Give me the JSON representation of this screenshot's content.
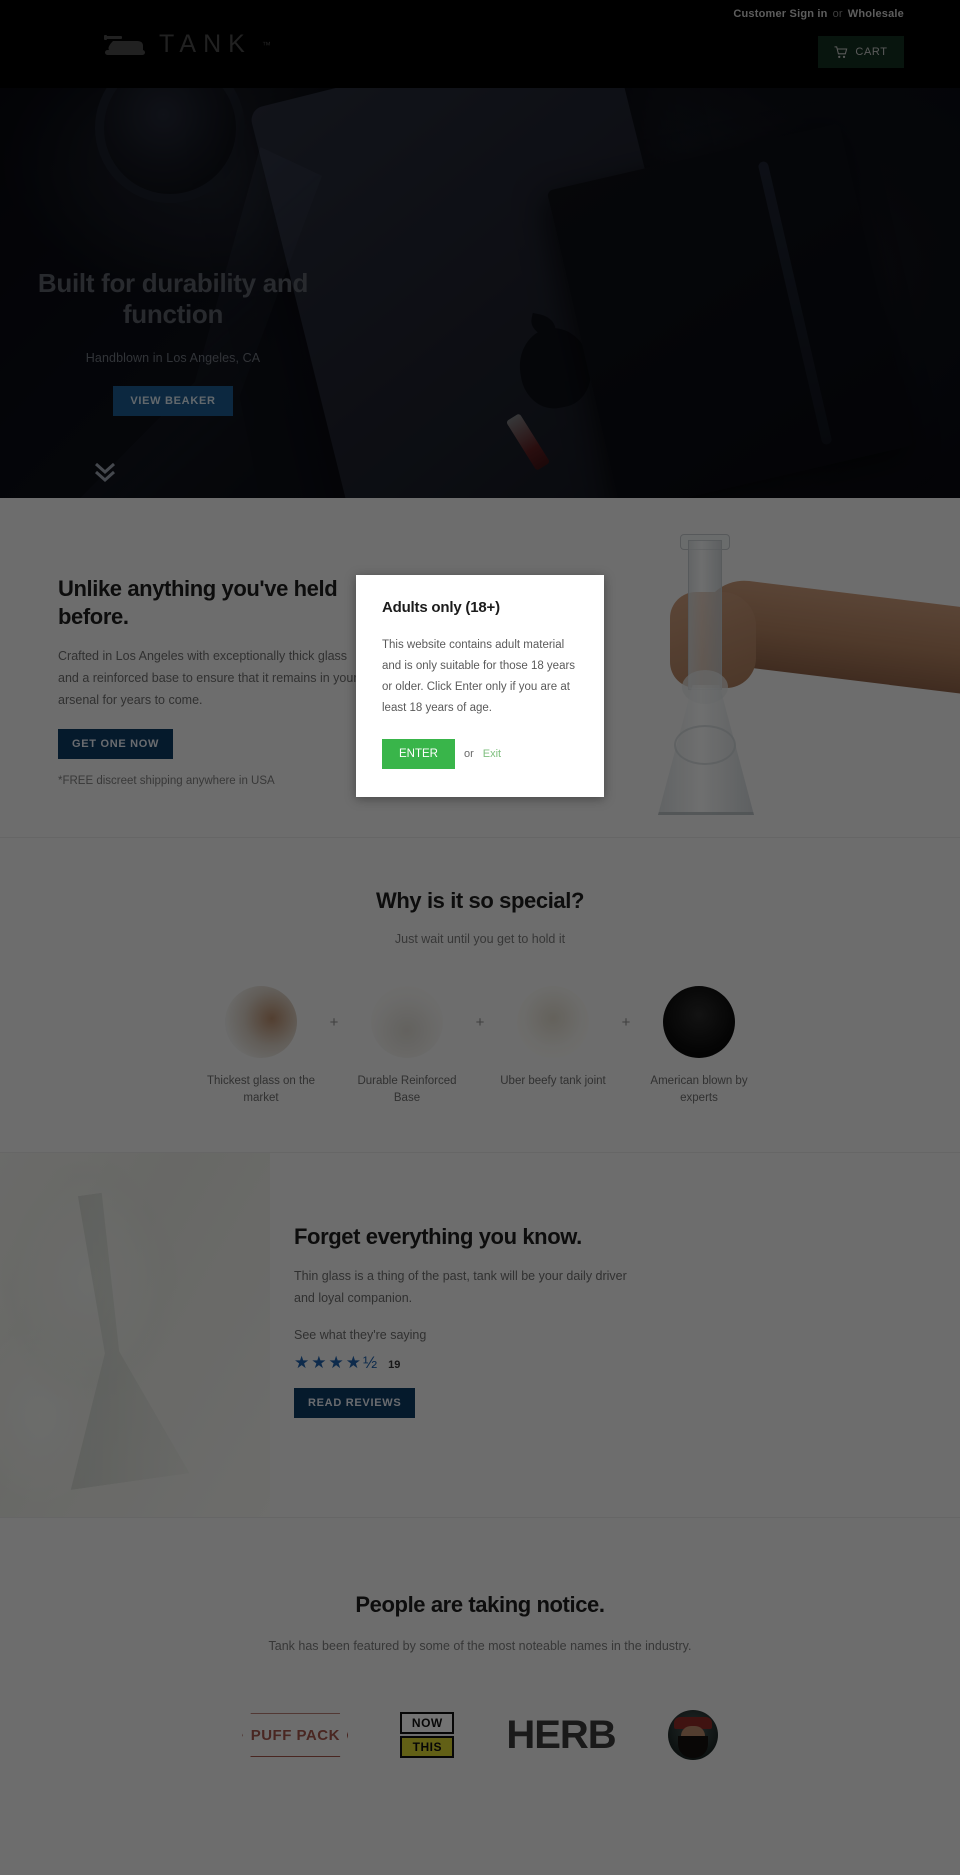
{
  "header": {
    "utility": {
      "signin_label": "Customer Sign in",
      "separator": "or",
      "wholesale_label": "Wholesale"
    },
    "logo": {
      "wordmark": "TANK",
      "tm": "™",
      "icon": "tank-icon"
    },
    "cart": {
      "label": "CART",
      "icon": "shopping-cart-icon",
      "bg": "#133020"
    }
  },
  "hero": {
    "title": "Built for durability and function",
    "subtitle": "Handblown in Los Angeles, CA",
    "cta_label": "VIEW BEAKER",
    "cta_color": "#1b5a8f",
    "scroll_icon": "double-chevron-down-icon"
  },
  "unlike": {
    "heading": "Unlike anything you've held before.",
    "body": "Crafted in Los Angeles with exceptionally thick glass and a reinforced base to ensure that it remains in your arsenal for years to come.",
    "cta_label": "GET ONE NOW",
    "cta_color": "#0d3a63",
    "footnote": "*FREE discreet shipping anywhere in USA"
  },
  "special": {
    "heading": "Why is it so special?",
    "subheading": "Just wait until you get to hold it",
    "separator": "+",
    "features": [
      {
        "caption": "Thickest glass on the market"
      },
      {
        "caption": "Durable Reinforced Base"
      },
      {
        "caption": "Uber beefy tank joint"
      },
      {
        "caption": "American blown by experts"
      }
    ]
  },
  "forget": {
    "heading": "Forget everything you know.",
    "body": "Thin glass is a thing of the past, tank will be your daily driver and loyal companion.",
    "see_what": "See what they're saying",
    "stars": "★★★★½",
    "rating": 4.5,
    "review_count": "19",
    "cta_label": "READ REVIEWS",
    "cta_color": "#0d3a63"
  },
  "press": {
    "heading": "People are taking notice.",
    "subheading": "Tank has been featured by some of the most noteable names in the industry.",
    "logos": [
      {
        "name": "puff-pack",
        "text": "PUFF PACK"
      },
      {
        "name": "now-this",
        "line1": "NOW",
        "line2": "THIS"
      },
      {
        "name": "herb",
        "text": "HERB"
      },
      {
        "name": "bearded-avatar",
        "text": ""
      }
    ]
  },
  "modal": {
    "title": "Adults only (18+)",
    "body": "This website contains adult material and is only suitable for those 18 years or older. Click Enter only if you are at least 18 years of age.",
    "enter_label": "ENTER",
    "or_label": "or",
    "exit_label": "Exit",
    "enter_color": "#39b54a"
  }
}
